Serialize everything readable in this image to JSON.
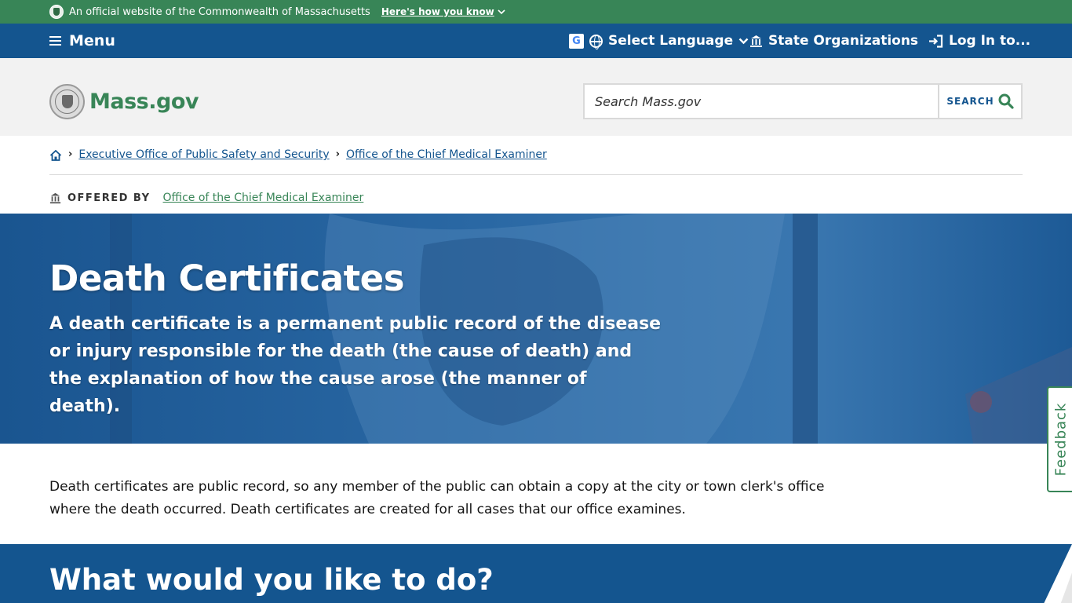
{
  "official_banner": {
    "text": "An official website of the Commonwealth of Massachusetts",
    "how_you_know": "Here's how you know"
  },
  "utility_nav": {
    "menu_label": "Menu",
    "google_letter": "G",
    "language_label": "Select Language",
    "state_orgs_label": "State Organizations",
    "login_label": "Log In to..."
  },
  "header": {
    "logo_text": "Mass.gov",
    "search_placeholder": "Search Mass.gov",
    "search_button": "SEARCH"
  },
  "breadcrumb": {
    "items": [
      "Executive Office of Public Safety and Security",
      "Office of the Chief Medical Examiner"
    ]
  },
  "offered_by": {
    "label": "OFFERED BY",
    "org": "Office of the Chief Medical Examiner"
  },
  "hero": {
    "title": "Death Certificates",
    "description": "A death certificate is a permanent public record of the disease or injury responsible for the death (the cause of death) and the explanation of how the cause arose (the manner of death)."
  },
  "intro": {
    "text": "Death certificates are public record, so any member of the public can obtain a copy at the city or town clerk's office where the death occurred. Death certificates are created for all cases that our office examines."
  },
  "section": {
    "title": "What would you like to do?"
  },
  "feedback": {
    "label": "Feedback"
  },
  "colors": {
    "green": "#388557",
    "blue": "#14558f",
    "header_gray": "#f2f2f2"
  }
}
